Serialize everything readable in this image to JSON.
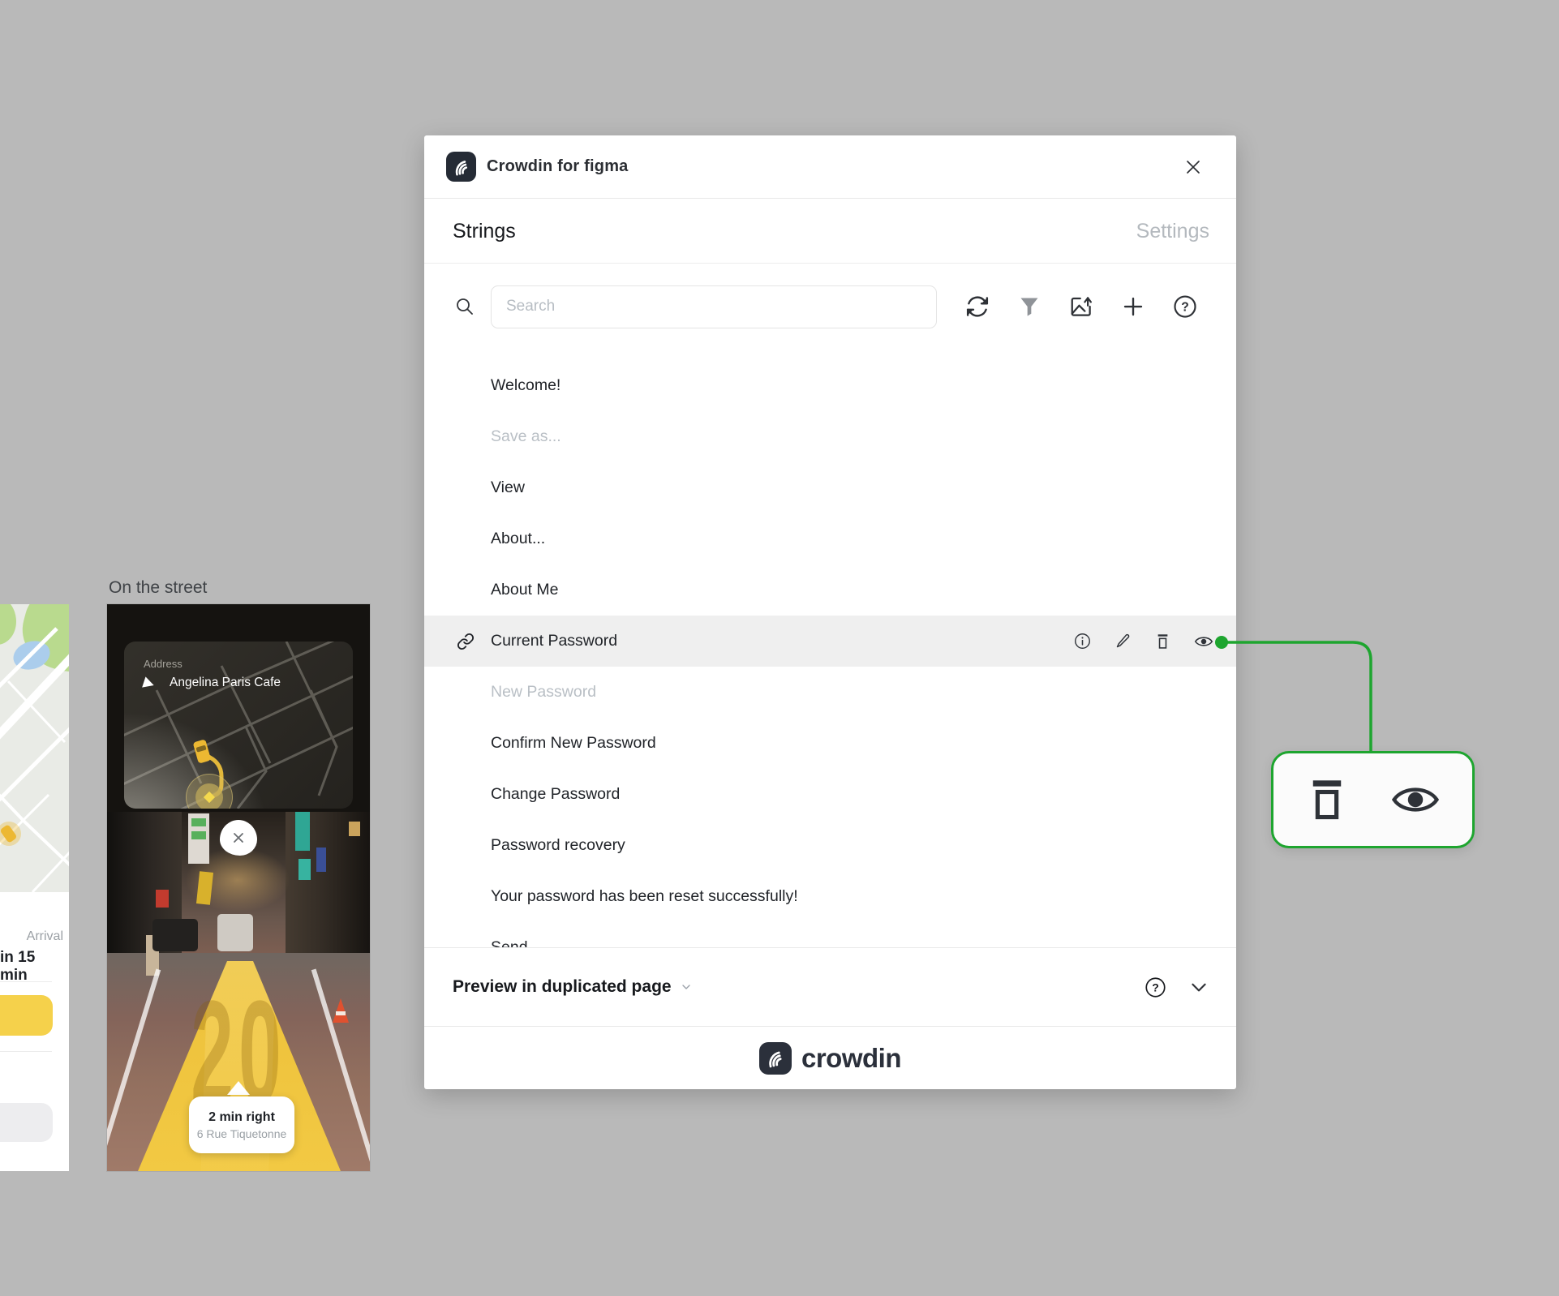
{
  "canvas": {
    "frame_label": "On the street",
    "background": "#b9b9b9"
  },
  "dialog": {
    "title": "Crowdin for figma",
    "tabs": {
      "strings": "Strings",
      "settings": "Settings"
    },
    "toolbar": {
      "search_placeholder": "Search",
      "icons": [
        "search-icon",
        "sync-icon",
        "filter-icon",
        "export-image-icon",
        "add-string-icon",
        "help-icon"
      ]
    },
    "strings": {
      "items": [
        {
          "label": "Welcome!",
          "state": "normal"
        },
        {
          "label": "Save as...",
          "state": "muted"
        },
        {
          "label": "View",
          "state": "normal"
        },
        {
          "label": "About...",
          "state": "normal"
        },
        {
          "label": "About Me",
          "state": "normal"
        },
        {
          "label": "Current Password",
          "state": "selected"
        },
        {
          "label": "New Password",
          "state": "muted"
        },
        {
          "label": "Confirm New Password",
          "state": "normal"
        },
        {
          "label": "Change Password",
          "state": "normal"
        },
        {
          "label": "Password recovery",
          "state": "normal"
        },
        {
          "label": "Your password has been reset successfully!",
          "state": "normal"
        },
        {
          "label": "Send",
          "state": "clipped"
        }
      ],
      "selected_row_actions": [
        "info-icon",
        "edit-icon",
        "delete-icon",
        "preview-icon"
      ]
    },
    "footer": {
      "preview_label": "Preview in duplicated page"
    },
    "brand_wordmark": "crowdin",
    "colors": {
      "accent_green": "#1ea52f",
      "selected_row_bg": "#efefef",
      "logo_navy": "#2b303b"
    }
  },
  "callout": {
    "icons": [
      "delete-icon",
      "preview-icon"
    ],
    "border_color": "#1ea52f"
  },
  "phone": {
    "address_card": {
      "label": "Address",
      "value": "Angelina Paris Cafe"
    },
    "direction_card": {
      "primary": "2 min right",
      "secondary": "6 Rue Tiquetonne"
    },
    "ar_path_number": "20",
    "colors": {
      "path_yellow": "#eec23c",
      "taxi_yellow": "#ecb832"
    }
  },
  "side_panel": {
    "arrival_label": "Arrival",
    "arrival_value": "in 15 min",
    "colors": {
      "button_yellow": "#f5d14b"
    }
  }
}
